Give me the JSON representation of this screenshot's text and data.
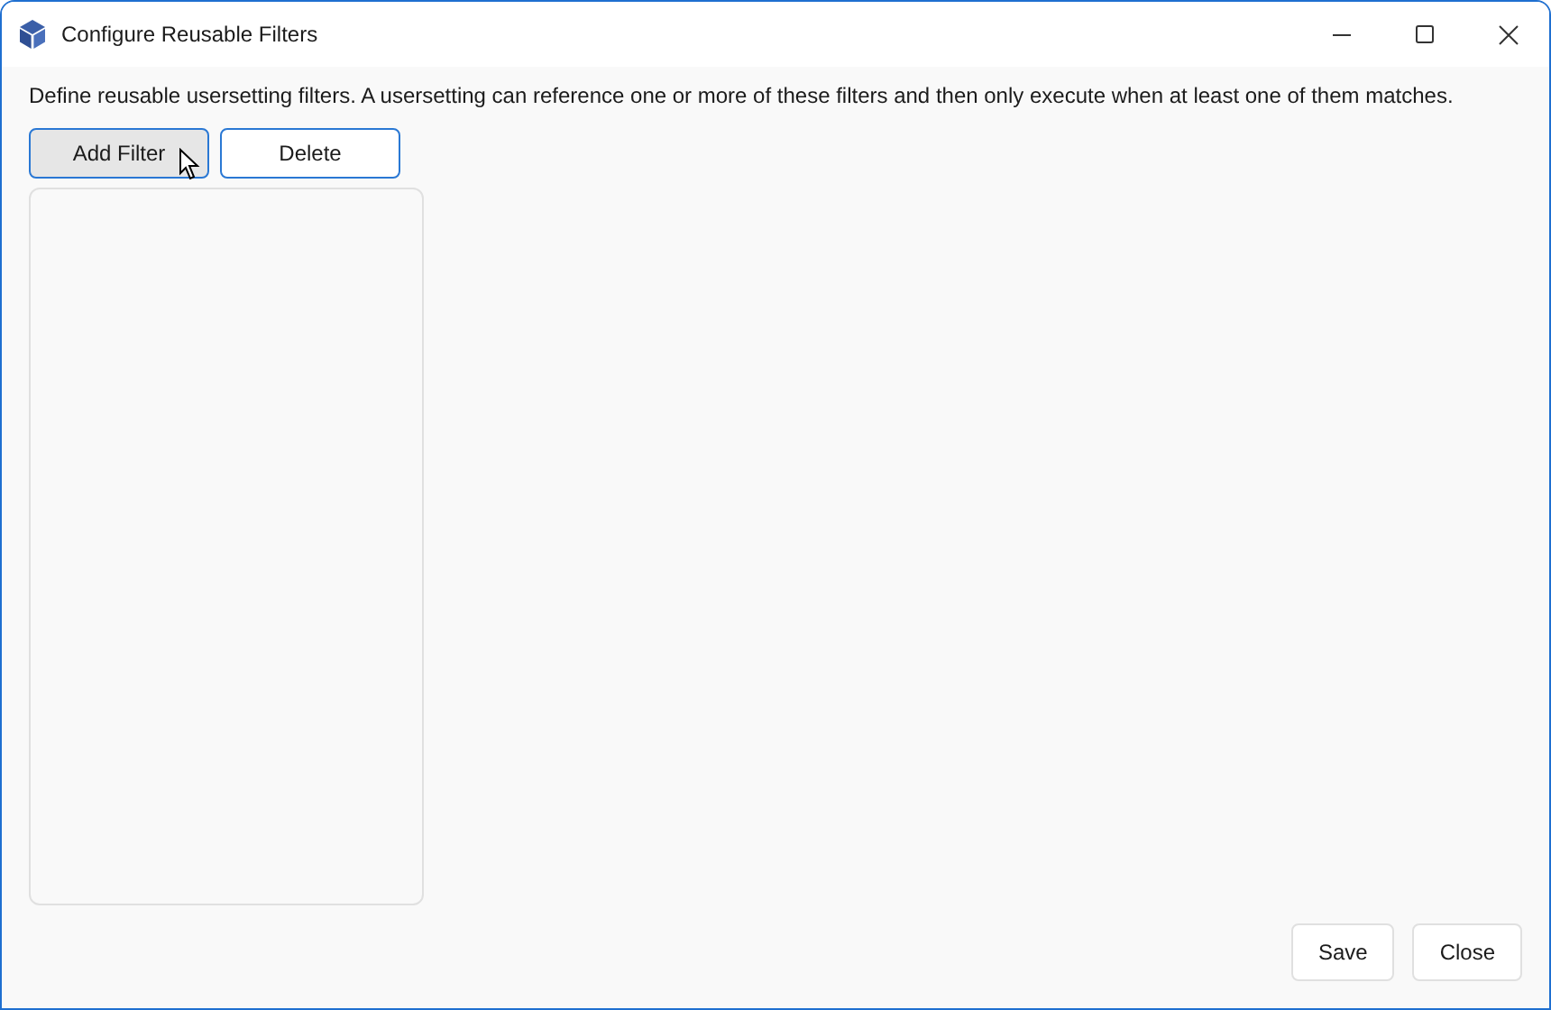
{
  "window": {
    "title": "Configure Reusable Filters"
  },
  "description": "Define reusable usersetting filters. A usersetting can reference one or more of these filters and then only execute when at least one of them matches.",
  "toolbar": [
    {
      "label": "Add Filter",
      "hovered": true
    },
    {
      "label": "Delete",
      "hovered": false
    }
  ],
  "footer_buttons": [
    "Save",
    "Close"
  ]
}
